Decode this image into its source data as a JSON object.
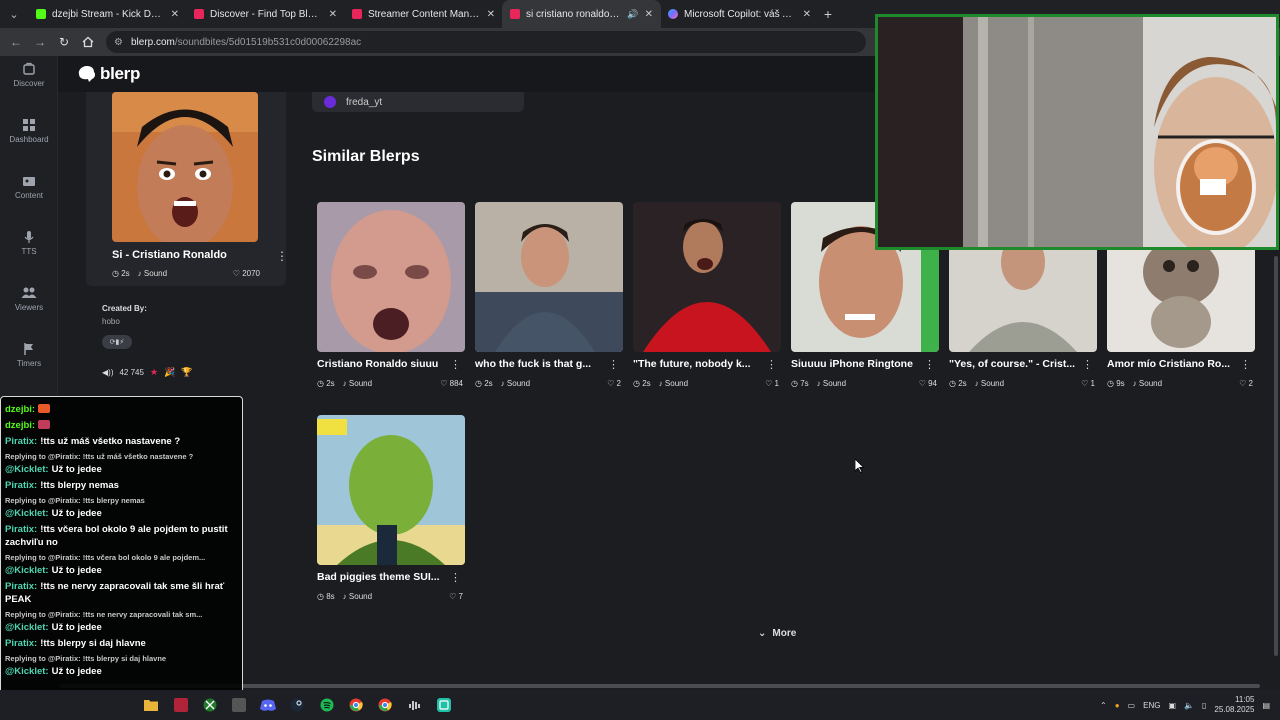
{
  "browser": {
    "tabs": [
      {
        "label": "dzejbi Stream - Kick Dashboard",
        "favicon_color": "#53fc18",
        "active": false
      },
      {
        "label": "Discover - Find Top Blerps, Stre",
        "favicon_color": "#e8265a",
        "active": false
      },
      {
        "label": "Streamer Content Manager",
        "favicon_color": "#e8265a",
        "active": false
      },
      {
        "label": "si cristiano ronaldo Best So",
        "favicon_color": "#e8265a",
        "active": true
      },
      {
        "label": "Microsoft Copilot: váš AI pomo",
        "favicon_color": "#7b6cff",
        "active": false
      }
    ],
    "url_host": "blerp.com",
    "url_path": "/soundbites/5d01519b531c0d00062298ac"
  },
  "rail": [
    {
      "label": "Discover",
      "icon": "discover-icon"
    },
    {
      "label": "Dashboard",
      "icon": "dashboard-icon"
    },
    {
      "label": "Content",
      "icon": "content-icon"
    },
    {
      "label": "TTS",
      "icon": "microphone-icon"
    },
    {
      "label": "Viewers",
      "icon": "viewers-icon"
    },
    {
      "label": "Timers",
      "icon": "flag-icon"
    }
  ],
  "header": {
    "brand": "blerp"
  },
  "detail": {
    "title": "Si - Cristiano Ronaldo",
    "duration": "2s",
    "type": "Sound",
    "likes": "2070",
    "created_by_label": "Created By:",
    "creator": "hobo",
    "plays": "42 745",
    "uploader": "freda_yt"
  },
  "similar": {
    "heading": "Similar Blerps",
    "items": [
      {
        "title": "Cristiano Ronaldo siuuu",
        "duration": "2s",
        "type": "Sound",
        "likes": "884"
      },
      {
        "title": "who the fuck is that g...",
        "duration": "2s",
        "type": "Sound",
        "likes": "2"
      },
      {
        "title": "\"The future, nobody k...",
        "duration": "2s",
        "type": "Sound",
        "likes": "1"
      },
      {
        "title": "Siuuuu iPhone Ringtone",
        "duration": "7s",
        "type": "Sound",
        "likes": "94"
      },
      {
        "title": "\"Yes, of course.\" - Crist...",
        "duration": "2s",
        "type": "Sound",
        "likes": "1"
      },
      {
        "title": "Amor mío Cristiano Ro...",
        "duration": "9s",
        "type": "Sound",
        "likes": "2"
      },
      {
        "title": "Bad piggies theme SUI...",
        "duration": "8s",
        "type": "Sound",
        "likes": "7"
      }
    ],
    "more_label": "More"
  },
  "chat": {
    "messages": [
      {
        "kind": "msg",
        "user": "dzejbi:",
        "color": "#53fc18",
        "text": ""
      },
      {
        "kind": "msg",
        "user": "dzejbi:",
        "color": "#53fc18",
        "text": ""
      },
      {
        "kind": "msg",
        "user": "Piratix:",
        "color": "#4fd6b0",
        "text": "!tts už máš všetko nastavene ?"
      },
      {
        "kind": "reply",
        "text": "Replying to @Piratix: !tts už máš všetko nastavene ?"
      },
      {
        "kind": "msg",
        "user": "@Kicklet:",
        "color": "#4fd6b0",
        "text": "Už to jedee"
      },
      {
        "kind": "msg",
        "user": "Piratix:",
        "color": "#4fd6b0",
        "text": "!tts blerpy nemas"
      },
      {
        "kind": "reply",
        "text": "Replying to @Piratix: !tts blerpy nemas"
      },
      {
        "kind": "msg",
        "user": "@Kicklet:",
        "color": "#4fd6b0",
        "text": "Už to jedee"
      },
      {
        "kind": "msg",
        "user": "Piratix:",
        "color": "#4fd6b0",
        "text": "!tts včera bol okolo 9 ale pojdem to pustit zachviľu no"
      },
      {
        "kind": "reply",
        "text": "Replying to @Piratix: !tts včera bol okolo 9 ale pojdem..."
      },
      {
        "kind": "msg",
        "user": "@Kicklet:",
        "color": "#4fd6b0",
        "text": "Už to jedee"
      },
      {
        "kind": "msg",
        "user": "Piratix:",
        "color": "#4fd6b0",
        "text": "!tts ne nervy zapracovali tak sme šli hrať PEAK"
      },
      {
        "kind": "reply",
        "text": "Replying to @Piratix: !tts ne nervy zapracovali tak sm..."
      },
      {
        "kind": "msg",
        "user": "@Kicklet:",
        "color": "#4fd6b0",
        "text": "Už to jedee"
      },
      {
        "kind": "msg",
        "user": "Piratix:",
        "color": "#4fd6b0",
        "text": "!tts blerpy si daj hlavne"
      },
      {
        "kind": "reply",
        "text": "Replying to @Piratix: !tts blerpy si daj hlavne"
      },
      {
        "kind": "msg",
        "user": "@Kicklet:",
        "color": "#4fd6b0",
        "text": "Už to jedee"
      }
    ]
  },
  "tray": {
    "lang": "ENG",
    "time": "11:05",
    "date": "25.08.2025"
  },
  "colors": {
    "accent": "#e8265a",
    "kick_green": "#53fc18",
    "bg": "#1b1d21"
  }
}
